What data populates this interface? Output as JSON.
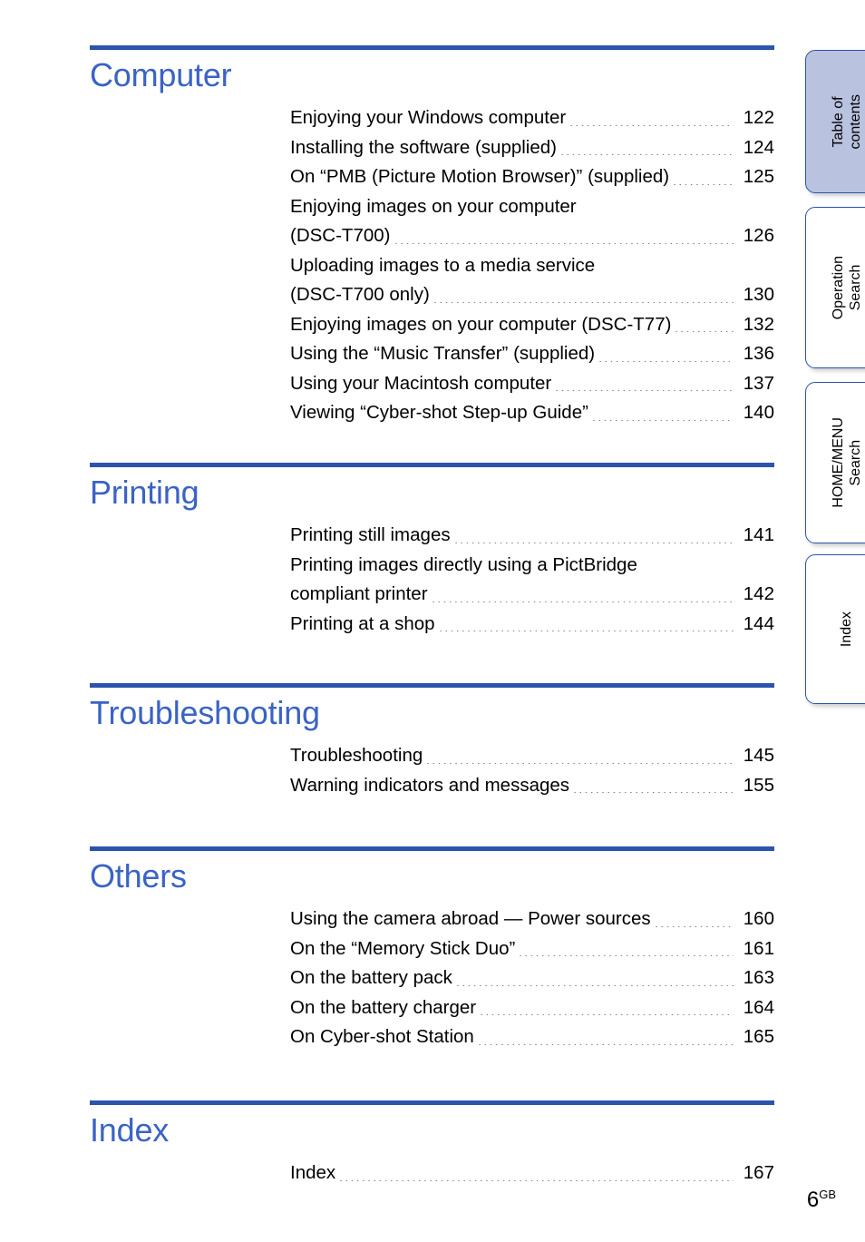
{
  "document": {
    "folio_number": "6",
    "folio_suffix": "GB"
  },
  "theme": {
    "rule_color": "#2B54AD",
    "heading_color": "#3A63C4",
    "active_tab_fill": "#B9C2DF",
    "tab_border": "#2B54AD",
    "text_color": "#000000"
  },
  "side_tabs": [
    {
      "label": "Table of\ncontents",
      "active": true
    },
    {
      "label": "Operation\nSearch",
      "active": false
    },
    {
      "label": "HOME/MENU\nSearch",
      "active": false
    },
    {
      "label": "Index",
      "active": false
    }
  ],
  "sections": [
    {
      "title": "Computer",
      "entries": [
        {
          "label": "Enjoying your Windows computer",
          "page": "122"
        },
        {
          "label": "Installing the software (supplied)",
          "page": "124"
        },
        {
          "label": "On “PMB (Picture Motion Browser)” (supplied)",
          "page": "125"
        },
        {
          "first_line": "Enjoying images on your computer",
          "label": "(DSC-T700)",
          "page": "126"
        },
        {
          "first_line": "Uploading images to a media service",
          "label": "(DSC-T700 only)",
          "page": "130"
        },
        {
          "label": "Enjoying images on your computer (DSC-T77)",
          "page": "132"
        },
        {
          "label": "Using the “Music Transfer” (supplied)",
          "page": "136"
        },
        {
          "label": "Using your Macintosh computer",
          "page": "137"
        },
        {
          "label": "Viewing “Cyber-shot Step-up Guide”",
          "page": "140"
        }
      ]
    },
    {
      "title": "Printing",
      "entries": [
        {
          "label": "Printing still images",
          "page": "141"
        },
        {
          "first_line": "Printing images directly using a PictBridge",
          "label": "compliant printer",
          "page": "142"
        },
        {
          "label": "Printing at a shop",
          "page": "144"
        }
      ]
    },
    {
      "title": "Troubleshooting",
      "entries": [
        {
          "label": "Troubleshooting",
          "page": "145"
        },
        {
          "label": "Warning indicators and messages",
          "page": "155"
        }
      ]
    },
    {
      "title": "Others",
      "entries": [
        {
          "label": "Using the camera abroad — Power sources",
          "page": "160"
        },
        {
          "label": "On the “Memory Stick Duo”",
          "page": "161"
        },
        {
          "label": "On the battery pack",
          "page": "163"
        },
        {
          "label": "On the battery charger",
          "page": "164"
        },
        {
          "label": "On Cyber-shot Station",
          "page": "165"
        }
      ]
    },
    {
      "title": "Index",
      "entries": [
        {
          "label": "Index",
          "page": "167"
        }
      ]
    }
  ]
}
